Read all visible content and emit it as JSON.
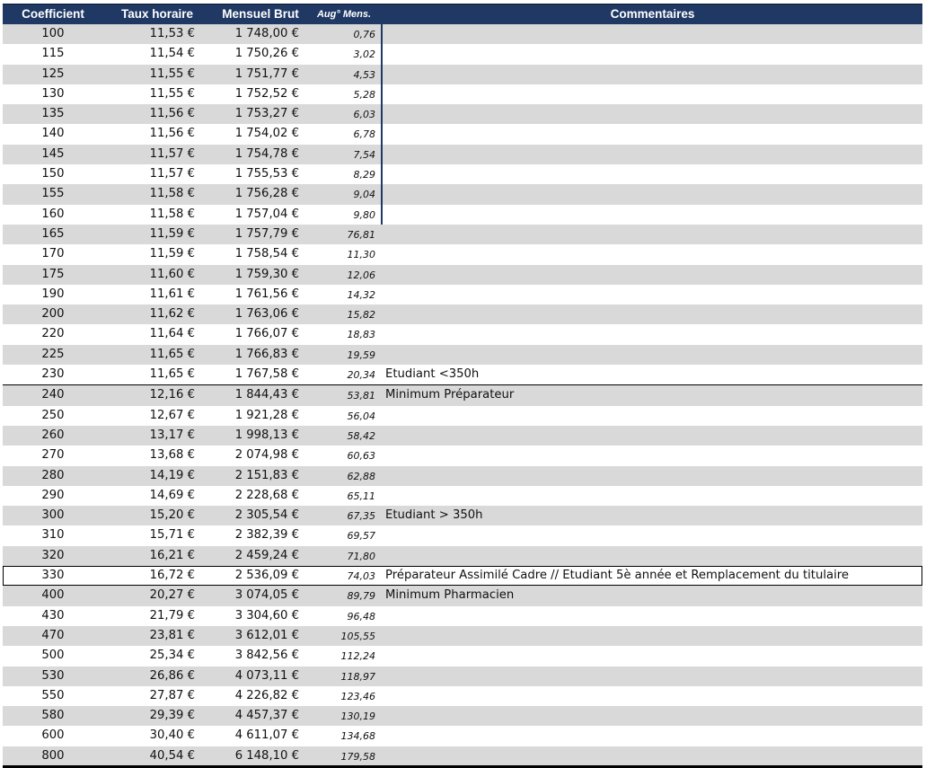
{
  "headers": {
    "coef": "Coefficient",
    "taux": "Taux horaire",
    "brut": "Mensuel Brut",
    "aug": "Aug° Mens.",
    "comm": "Commentaires"
  },
  "rows": [
    {
      "coef": "100",
      "taux": "11,53 €",
      "brut": "1 748,00 €",
      "aug": "0,76",
      "comm": ""
    },
    {
      "coef": "115",
      "taux": "11,54 €",
      "brut": "1 750,26 €",
      "aug": "3,02",
      "comm": ""
    },
    {
      "coef": "125",
      "taux": "11,55 €",
      "brut": "1 751,77 €",
      "aug": "4,53",
      "comm": ""
    },
    {
      "coef": "130",
      "taux": "11,55 €",
      "brut": "1 752,52 €",
      "aug": "5,28",
      "comm": ""
    },
    {
      "coef": "135",
      "taux": "11,56 €",
      "brut": "1 753,27 €",
      "aug": "6,03",
      "comm": ""
    },
    {
      "coef": "140",
      "taux": "11,56 €",
      "brut": "1 754,02 €",
      "aug": "6,78",
      "comm": ""
    },
    {
      "coef": "145",
      "taux": "11,57 €",
      "brut": "1 754,78 €",
      "aug": "7,54",
      "comm": ""
    },
    {
      "coef": "150",
      "taux": "11,57 €",
      "brut": "1 755,53 €",
      "aug": "8,29",
      "comm": ""
    },
    {
      "coef": "155",
      "taux": "11,58 €",
      "brut": "1 756,28 €",
      "aug": "9,04",
      "comm": ""
    },
    {
      "coef": "160",
      "taux": "11,58 €",
      "brut": "1 757,04 €",
      "aug": "9,80",
      "comm": ""
    },
    {
      "coef": "165",
      "taux": "11,59 €",
      "brut": "1 757,79 €",
      "aug": "76,81",
      "comm": ""
    },
    {
      "coef": "170",
      "taux": "11,59 €",
      "brut": "1 758,54 €",
      "aug": "11,30",
      "comm": ""
    },
    {
      "coef": "175",
      "taux": "11,60 €",
      "brut": "1 759,30 €",
      "aug": "12,06",
      "comm": ""
    },
    {
      "coef": "190",
      "taux": "11,61 €",
      "brut": "1 761,56 €",
      "aug": "14,32",
      "comm": ""
    },
    {
      "coef": "200",
      "taux": "11,62 €",
      "brut": "1 763,06 €",
      "aug": "15,82",
      "comm": ""
    },
    {
      "coef": "220",
      "taux": "11,64 €",
      "brut": "1 766,07 €",
      "aug": "18,83",
      "comm": ""
    },
    {
      "coef": "225",
      "taux": "11,65 €",
      "brut": "1 766,83 €",
      "aug": "19,59",
      "comm": ""
    },
    {
      "coef": "230",
      "taux": "11,65 €",
      "brut": "1 767,58 €",
      "aug": "20,34",
      "comm": "Etudiant <350h"
    },
    {
      "coef": "240",
      "taux": "12,16 €",
      "brut": "1 844,43 €",
      "aug": "53,81",
      "comm": "Minimum Préparateur"
    },
    {
      "coef": "250",
      "taux": "12,67 €",
      "brut": "1 921,28 €",
      "aug": "56,04",
      "comm": ""
    },
    {
      "coef": "260",
      "taux": "13,17 €",
      "brut": "1 998,13 €",
      "aug": "58,42",
      "comm": ""
    },
    {
      "coef": "270",
      "taux": "13,68 €",
      "brut": "2 074,98 €",
      "aug": "60,63",
      "comm": ""
    },
    {
      "coef": "280",
      "taux": "14,19 €",
      "brut": "2 151,83 €",
      "aug": "62,88",
      "comm": ""
    },
    {
      "coef": "290",
      "taux": "14,69 €",
      "brut": "2 228,68 €",
      "aug": "65,11",
      "comm": ""
    },
    {
      "coef": "300",
      "taux": "15,20 €",
      "brut": "2 305,54 €",
      "aug": "67,35",
      "comm": "Etudiant > 350h"
    },
    {
      "coef": "310",
      "taux": "15,71 €",
      "brut": "2 382,39 €",
      "aug": "69,57",
      "comm": ""
    },
    {
      "coef": "320",
      "taux": "16,21 €",
      "brut": "2 459,24 €",
      "aug": "71,80",
      "comm": ""
    },
    {
      "coef": "330",
      "taux": "16,72 €",
      "brut": "2 536,09 €",
      "aug": "74,03",
      "comm": "Préparateur Assimilé Cadre // Etudiant 5è année et Remplacement du titulaire"
    },
    {
      "coef": "400",
      "taux": "20,27 €",
      "brut": "3 074,05 €",
      "aug": "89,79",
      "comm": "Minimum Pharmacien"
    },
    {
      "coef": "430",
      "taux": "21,79 €",
      "brut": "3 304,60 €",
      "aug": "96,48",
      "comm": ""
    },
    {
      "coef": "470",
      "taux": "23,81 €",
      "brut": "3 612,01 €",
      "aug": "105,55",
      "comm": ""
    },
    {
      "coef": "500",
      "taux": "25,34 €",
      "brut": "3 842,56 €",
      "aug": "112,24",
      "comm": ""
    },
    {
      "coef": "530",
      "taux": "26,86 €",
      "brut": "4 073,11 €",
      "aug": "118,97",
      "comm": ""
    },
    {
      "coef": "550",
      "taux": "27,87 €",
      "brut": "4 226,82 €",
      "aug": "123,46",
      "comm": ""
    },
    {
      "coef": "580",
      "taux": "29,39 €",
      "brut": "4 457,37 €",
      "aug": "130,19",
      "comm": ""
    },
    {
      "coef": "600",
      "taux": "30,40 €",
      "brut": "4 611,07 €",
      "aug": "134,68",
      "comm": ""
    },
    {
      "coef": "800",
      "taux": "40,54 €",
      "brut": "6 148,10 €",
      "aug": "179,58",
      "comm": ""
    }
  ]
}
